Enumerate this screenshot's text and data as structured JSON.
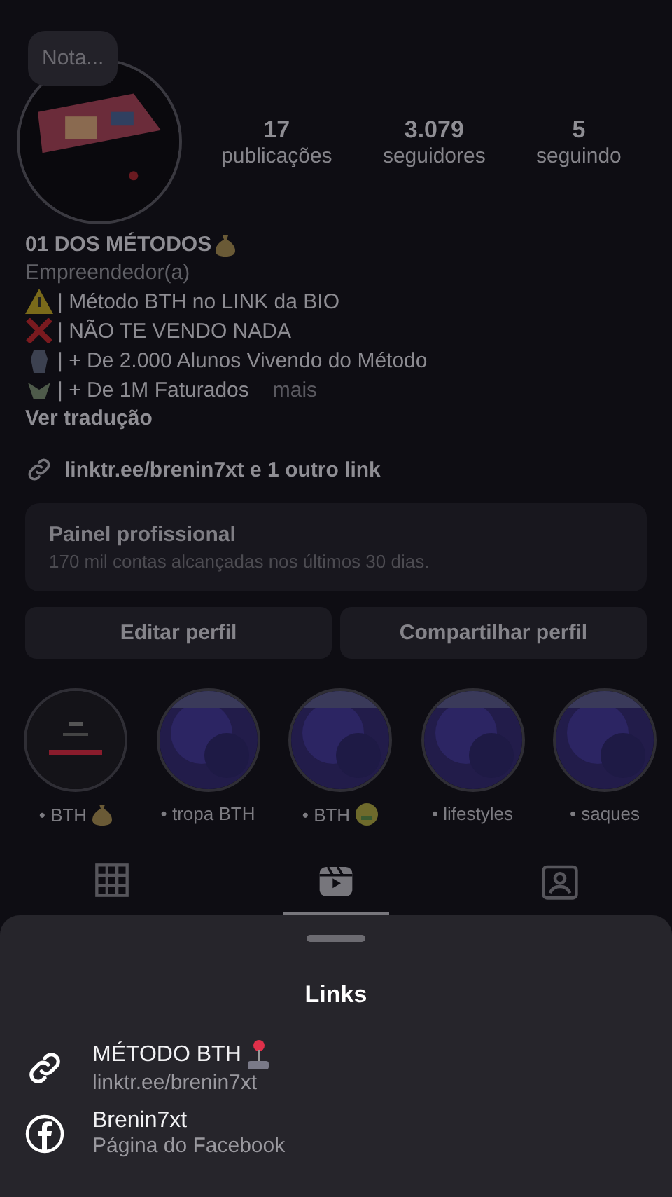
{
  "note": {
    "placeholder": "Nota..."
  },
  "stats": [
    {
      "value": "17",
      "label": "publicações"
    },
    {
      "value": "3.079",
      "label": "seguidores"
    },
    {
      "value": "5",
      "label": "seguindo"
    }
  ],
  "profile": {
    "name": "01 DOS MÉTODOS",
    "category": "Empreendedor(a)",
    "bio": [
      "| Método BTH no LINK da BIO",
      "| NÃO TE VENDO NADA",
      "| + De 2.000 Alunos Vivendo do Método",
      "| + De 1M Faturados"
    ],
    "more": "mais",
    "translate": "Ver tradução",
    "link": "linktr.ee/brenin7xt e 1 outro link"
  },
  "dashboard": {
    "title": "Painel profissional",
    "subtitle": "170 mil contas alcançadas nos últimos 30 dias."
  },
  "buttons": [
    "Editar perfil",
    "Compartilhar perfil"
  ],
  "highlights": [
    {
      "label": "• BTH",
      "emoji": true
    },
    {
      "label": "• tropa BTH",
      "emoji": false
    },
    {
      "label": "• BTH",
      "emoji": true
    },
    {
      "label": "• lifestyles",
      "emoji": false
    },
    {
      "label": "• saques",
      "emoji": false
    }
  ],
  "tabs": [
    {
      "kind": "grid",
      "selected": false
    },
    {
      "kind": "reels",
      "selected": true
    },
    {
      "kind": "tagged",
      "selected": false
    }
  ],
  "sheet": {
    "title": "Links",
    "links": [
      {
        "kind": "link",
        "title": "MÉTODO BTH",
        "url": "linktr.ee/brenin7xt"
      },
      {
        "kind": "facebook",
        "title": "Brenin7xt",
        "url": "Página do Facebook"
      }
    ]
  }
}
